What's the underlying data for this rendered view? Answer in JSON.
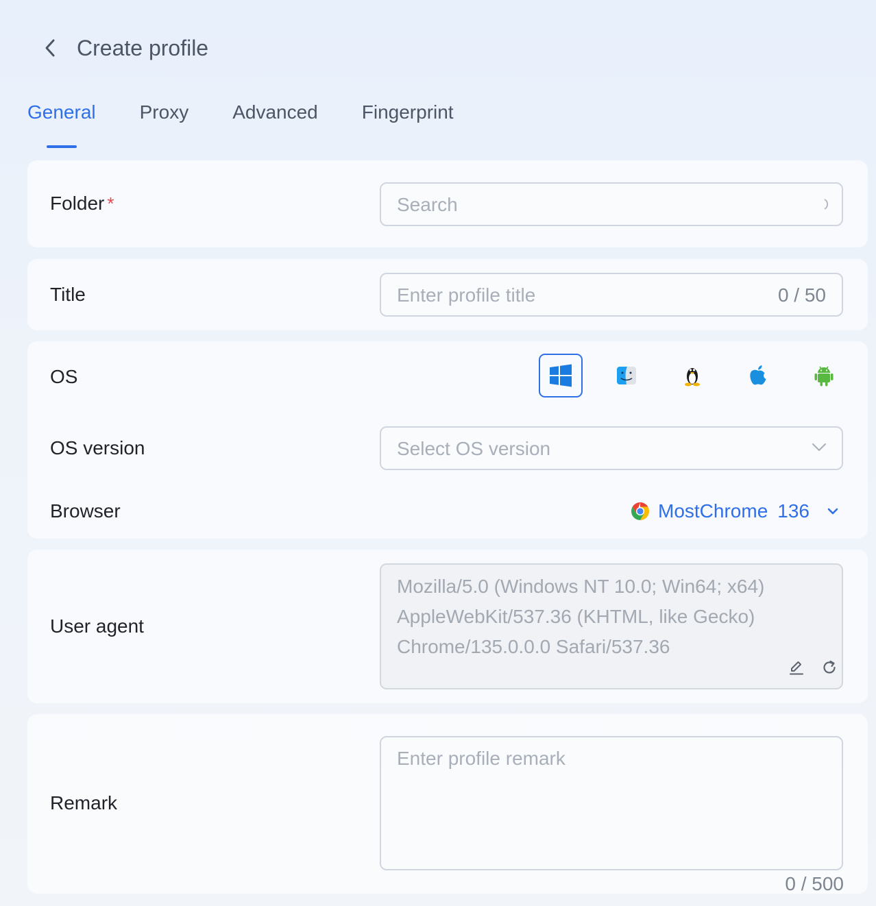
{
  "header": {
    "title": "Create profile"
  },
  "tabs": [
    {
      "label": "General"
    },
    {
      "label": "Proxy"
    },
    {
      "label": "Advanced"
    },
    {
      "label": "Fingerprint"
    }
  ],
  "folder": {
    "label": "Folder",
    "required_mark": "*",
    "placeholder": "Search",
    "suffix_icon": "spinner-icon"
  },
  "title_field": {
    "label": "Title",
    "placeholder": "Enter profile title",
    "counter": "0 / 50"
  },
  "os": {
    "label": "OS",
    "options": [
      {
        "name": "windows-icon",
        "selected": true
      },
      {
        "name": "macos-finder-icon",
        "selected": false
      },
      {
        "name": "linux-icon",
        "selected": false
      },
      {
        "name": "apple-icon",
        "selected": false
      },
      {
        "name": "android-icon",
        "selected": false
      }
    ],
    "accent": "#2f6fe8"
  },
  "os_version": {
    "label": "OS version",
    "placeholder": "Select OS version"
  },
  "browser": {
    "label": "Browser",
    "name": "MostChrome",
    "version": "136",
    "color": "#2f6fe8"
  },
  "user_agent": {
    "label": "User agent",
    "lines": [
      "Mozilla/5.0 (Windows NT 10.0; Win64; x64)",
      "AppleWebKit/537.36 (KHTML, like Gecko)",
      "Chrome/135.0.0.0 Safari/537.36"
    ]
  },
  "remark": {
    "label": "Remark",
    "placeholder": "Enter profile remark",
    "counter": "0 / 500"
  }
}
